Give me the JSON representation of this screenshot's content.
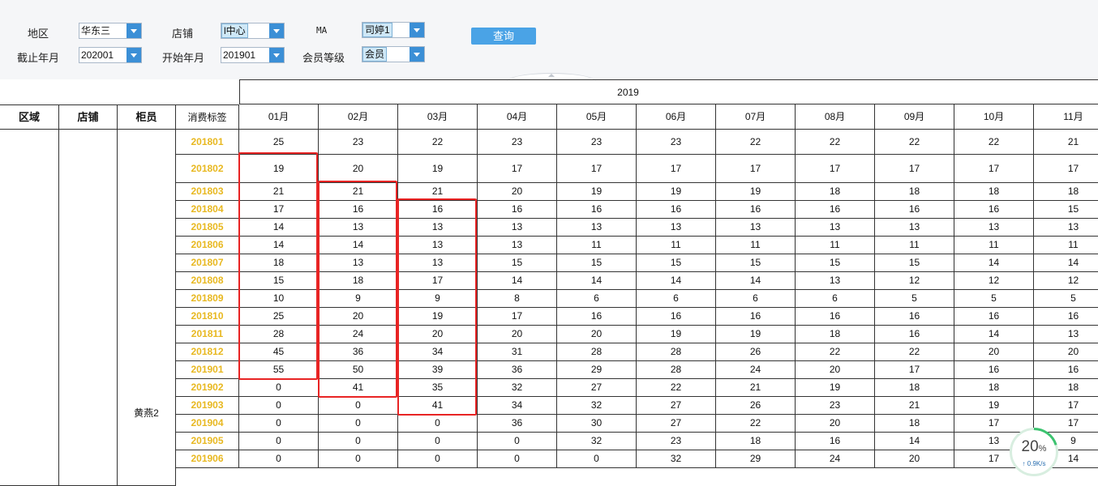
{
  "filters": {
    "region_label": "地区",
    "region_value": "华东三",
    "store_label": "店铺",
    "store_value": "l中心",
    "ma_label": "MA",
    "ma_value": "司婷1",
    "end_month_label": "截止年月",
    "end_month_value": "202001",
    "start_month_label": "开始年月",
    "start_month_value": "201901",
    "member_level_label": "会员等级",
    "member_level_value": "会员"
  },
  "query_button_label": "查询",
  "table": {
    "year_header": "2019",
    "fixed_headers": [
      "区域",
      "店铺",
      "柜员",
      "消费标签"
    ],
    "month_headers": [
      "01月",
      "02月",
      "03月",
      "04月",
      "05月",
      "06月",
      "07月",
      "08月",
      "09月",
      "10月",
      "11月"
    ],
    "staff_name": "黄燕2",
    "rows": [
      {
        "tag": "201801",
        "values": [
          "25",
          "23",
          "22",
          "23",
          "23",
          "23",
          "22",
          "22",
          "22",
          "22",
          "21"
        ]
      },
      {
        "tag": "201802",
        "values": [
          "19",
          "20",
          "19",
          "17",
          "17",
          "17",
          "17",
          "17",
          "17",
          "17",
          "17"
        ]
      },
      {
        "tag": "201803",
        "values": [
          "21",
          "21",
          "21",
          "20",
          "19",
          "19",
          "19",
          "18",
          "18",
          "18",
          "18"
        ]
      },
      {
        "tag": "201804",
        "values": [
          "17",
          "16",
          "16",
          "16",
          "16",
          "16",
          "16",
          "16",
          "16",
          "16",
          "15"
        ]
      },
      {
        "tag": "201805",
        "values": [
          "14",
          "13",
          "13",
          "13",
          "13",
          "13",
          "13",
          "13",
          "13",
          "13",
          "13"
        ]
      },
      {
        "tag": "201806",
        "values": [
          "14",
          "14",
          "13",
          "13",
          "11",
          "11",
          "11",
          "11",
          "11",
          "11",
          "11"
        ]
      },
      {
        "tag": "201807",
        "values": [
          "18",
          "13",
          "13",
          "15",
          "15",
          "15",
          "15",
          "15",
          "15",
          "14",
          "14"
        ]
      },
      {
        "tag": "201808",
        "values": [
          "15",
          "18",
          "17",
          "14",
          "14",
          "14",
          "14",
          "13",
          "12",
          "12",
          "12"
        ]
      },
      {
        "tag": "201809",
        "values": [
          "10",
          "9",
          "9",
          "8",
          "6",
          "6",
          "6",
          "6",
          "5",
          "5",
          "5"
        ]
      },
      {
        "tag": "201810",
        "values": [
          "25",
          "20",
          "19",
          "17",
          "16",
          "16",
          "16",
          "16",
          "16",
          "16",
          "16"
        ]
      },
      {
        "tag": "201811",
        "values": [
          "28",
          "24",
          "20",
          "20",
          "20",
          "19",
          "19",
          "18",
          "16",
          "14",
          "13"
        ]
      },
      {
        "tag": "201812",
        "values": [
          "45",
          "36",
          "34",
          "31",
          "28",
          "28",
          "26",
          "22",
          "22",
          "20",
          "20"
        ]
      },
      {
        "tag": "201901",
        "values": [
          "55",
          "50",
          "39",
          "36",
          "29",
          "28",
          "24",
          "20",
          "17",
          "16",
          "16"
        ]
      },
      {
        "tag": "201902",
        "values": [
          "0",
          "41",
          "35",
          "32",
          "27",
          "22",
          "21",
          "19",
          "18",
          "18",
          "18"
        ]
      },
      {
        "tag": "201903",
        "values": [
          "0",
          "0",
          "41",
          "34",
          "32",
          "27",
          "26",
          "23",
          "21",
          "19",
          "17"
        ]
      },
      {
        "tag": "201904",
        "values": [
          "0",
          "0",
          "0",
          "36",
          "30",
          "27",
          "22",
          "20",
          "18",
          "17",
          "17"
        ]
      },
      {
        "tag": "201905",
        "values": [
          "0",
          "0",
          "0",
          "0",
          "32",
          "23",
          "18",
          "16",
          "14",
          "13",
          "9"
        ]
      },
      {
        "tag": "201906",
        "values": [
          "0",
          "0",
          "0",
          "0",
          "0",
          "32",
          "29",
          "24",
          "20",
          "17",
          "14"
        ]
      }
    ]
  },
  "speed_widget": {
    "percent": "20",
    "percent_unit": "%",
    "rate": "↑ 0.9K/s",
    "progress_fraction": 0.2
  }
}
